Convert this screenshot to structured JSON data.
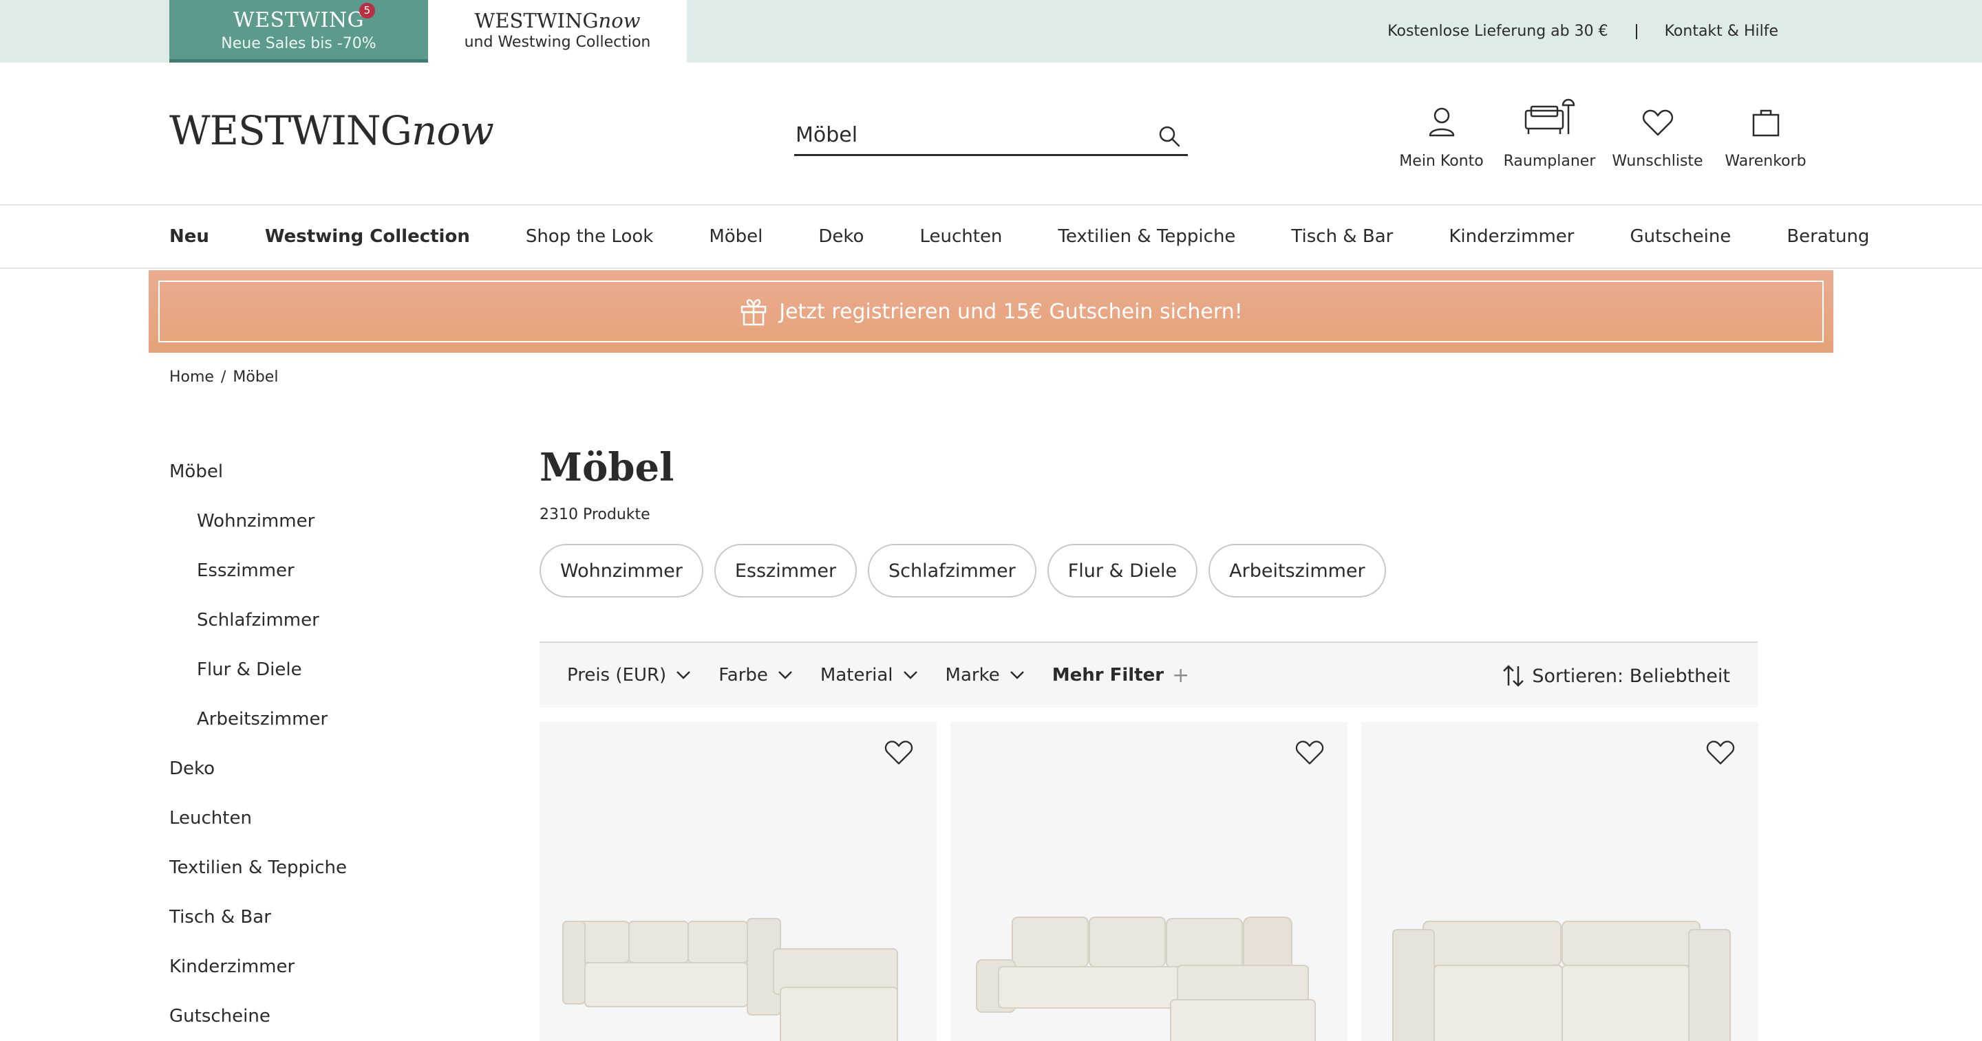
{
  "topbar": {
    "sales_tab": {
      "logo": "WESTWING",
      "badge": "5",
      "subtitle": "Neue Sales bis -70%"
    },
    "now_tab": {
      "logo_main": "WESTWING",
      "logo_italic": "now",
      "subtitle": "und Westwing Collection"
    },
    "links": [
      "Kostenlose Lieferung ab 30 €",
      "Kontakt & Hilfe"
    ]
  },
  "header": {
    "logo_main": "WESTWING",
    "logo_italic": "now",
    "search": {
      "value": "Möbel",
      "placeholder": ""
    },
    "icons": [
      {
        "name": "account-icon",
        "label": "Mein Konto"
      },
      {
        "name": "room-planner-icon",
        "label": "Raumplaner"
      },
      {
        "name": "heart-icon",
        "label": "Wunschliste"
      },
      {
        "name": "bag-icon",
        "label": "Warenkorb"
      }
    ]
  },
  "nav": {
    "items": [
      "Neu",
      "Westwing Collection",
      "Shop the Look",
      "Möbel",
      "Deko",
      "Leuchten",
      "Textilien & Teppiche",
      "Tisch & Bar",
      "Kinderzimmer",
      "Gutscheine",
      "Beratung"
    ]
  },
  "promo": {
    "text": "Jetzt registrieren und 15€ Gutschein sichern!",
    "icon": "gift-icon"
  },
  "breadcrumb": {
    "items": [
      "Home",
      "Möbel"
    ],
    "separator": "/"
  },
  "sidebar": {
    "items": [
      {
        "label": "Möbel",
        "level": 0
      },
      {
        "label": "Wohnzimmer",
        "level": 1
      },
      {
        "label": "Esszimmer",
        "level": 1
      },
      {
        "label": "Schlafzimmer",
        "level": 1
      },
      {
        "label": "Flur & Diele",
        "level": 1
      },
      {
        "label": "Arbeitszimmer",
        "level": 1
      },
      {
        "label": "Deko",
        "level": 0
      },
      {
        "label": "Leuchten",
        "level": 0
      },
      {
        "label": "Textilien & Teppiche",
        "level": 0
      },
      {
        "label": "Tisch & Bar",
        "level": 0
      },
      {
        "label": "Kinderzimmer",
        "level": 0
      },
      {
        "label": "Gutscheine",
        "level": 0
      }
    ]
  },
  "main": {
    "title": "Möbel",
    "count": "2310 Produkte",
    "chips": [
      "Wohnzimmer",
      "Esszimmer",
      "Schlafzimmer",
      "Flur & Diele",
      "Arbeitszimmer"
    ],
    "filters": [
      "Preis (EUR)",
      "Farbe",
      "Material",
      "Marke"
    ],
    "more_filters": "Mehr Filter",
    "more_filters_icon": "+",
    "sort": "Sortieren: Beliebtheit"
  },
  "products": [
    {
      "image": "modular-corner-sofa",
      "favorite_icon": "heart-icon"
    },
    {
      "image": "corner-sofa-with-cushions",
      "favorite_icon": "heart-icon"
    },
    {
      "image": "modular-two-seat-sofa",
      "favorite_icon": "heart-icon"
    }
  ],
  "colors": {
    "topbar_bg": "#deebe8",
    "sales_tab_bg": "#5b9a8c",
    "badge": "#b73145",
    "promo_bg": "#e8a583",
    "text": "#2b2b2b",
    "card_bg": "#f6f6f6"
  }
}
